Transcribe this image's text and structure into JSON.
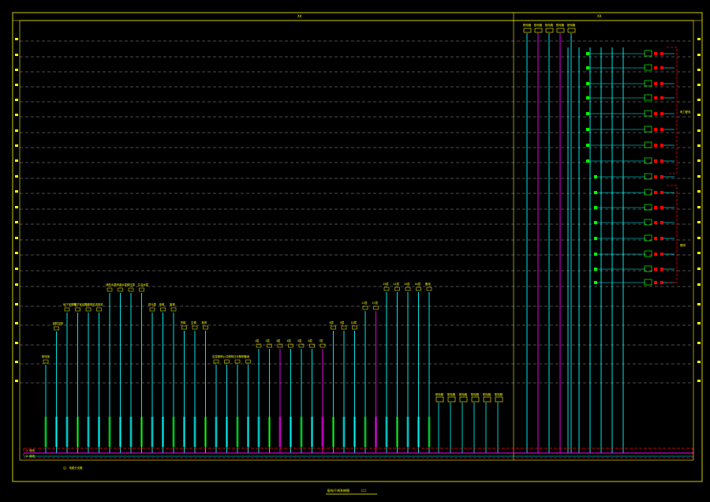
{
  "drawing": {
    "title": "配电干线系统图",
    "title_suffix": "（二）",
    "top_label_left": "XX",
    "top_label_right": "XX",
    "bus_label_top": "1 母线",
    "bus_label_bottom": "2 母线",
    "note": "注: 电缆分支箱",
    "right_group_label_1": "电力配电",
    "right_group_label_2": "照明"
  },
  "colors": {
    "background": "#000000",
    "frame": "#ffff00",
    "grid": "#ffffff",
    "feeder_cyan": "#00ffff",
    "feeder_magenta": "#ff00ff",
    "bus_red": "#ff0000",
    "device_green": "#00ff00",
    "text_yellow": "#ffff00"
  },
  "left_feeders": [
    {
      "top_label": "配电室",
      "color": "cyan"
    },
    {
      "top_label": "消防控制",
      "color": "cyan"
    },
    {
      "top_label": "地下室照明",
      "color": "cyan"
    },
    {
      "top_label": "地下室动力",
      "color": "cyan"
    },
    {
      "top_label": "排烟风机",
      "color": "cyan"
    },
    {
      "top_label": "送风机",
      "color": "cyan"
    },
    {
      "top_label": "消防水泵",
      "color": "cyan"
    },
    {
      "top_label": "喷淋水泵",
      "color": "cyan"
    },
    {
      "top_label": "稳压泵",
      "color": "cyan"
    },
    {
      "top_label": "生活水泵",
      "color": "cyan"
    },
    {
      "top_label": "排污泵",
      "color": "cyan"
    },
    {
      "top_label": "电梯",
      "color": "cyan"
    },
    {
      "top_label": "客梯",
      "color": "cyan"
    },
    {
      "top_label": "货梯",
      "color": "cyan"
    },
    {
      "top_label": "空调",
      "color": "cyan"
    },
    {
      "top_label": "新风",
      "color": "cyan"
    },
    {
      "top_label": "应急照明",
      "color": "cyan"
    },
    {
      "top_label": "公共照明",
      "color": "cyan"
    },
    {
      "top_label": "泛光照明",
      "color": "cyan"
    },
    {
      "top_label": "备用",
      "color": "cyan"
    },
    {
      "top_label": "1层",
      "color": "cyan"
    },
    {
      "top_label": "2层",
      "color": "cyan"
    },
    {
      "top_label": "3层",
      "color": "magenta"
    },
    {
      "top_label": "4层",
      "color": "cyan"
    },
    {
      "top_label": "5层",
      "color": "cyan"
    },
    {
      "top_label": "6层",
      "color": "cyan"
    },
    {
      "top_label": "7层",
      "color": "magenta"
    },
    {
      "top_label": "8层",
      "color": "cyan"
    },
    {
      "top_label": "9层",
      "color": "cyan"
    },
    {
      "top_label": "10层",
      "color": "cyan"
    },
    {
      "top_label": "11层",
      "color": "cyan"
    },
    {
      "top_label": "12层",
      "color": "magenta"
    },
    {
      "top_label": "13层",
      "color": "cyan"
    },
    {
      "top_label": "14层",
      "color": "cyan"
    },
    {
      "top_label": "15层",
      "color": "cyan"
    },
    {
      "top_label": "16层",
      "color": "cyan"
    },
    {
      "top_label": "备用",
      "color": "cyan"
    }
  ],
  "bottom_boxes": [
    "配电箱",
    "配电箱",
    "配电箱",
    "配电箱",
    "配电箱",
    "配电箱"
  ],
  "right_top_boxes": [
    "配电箱",
    "配电箱",
    "配电箱",
    "配电箱",
    "配电箱"
  ]
}
